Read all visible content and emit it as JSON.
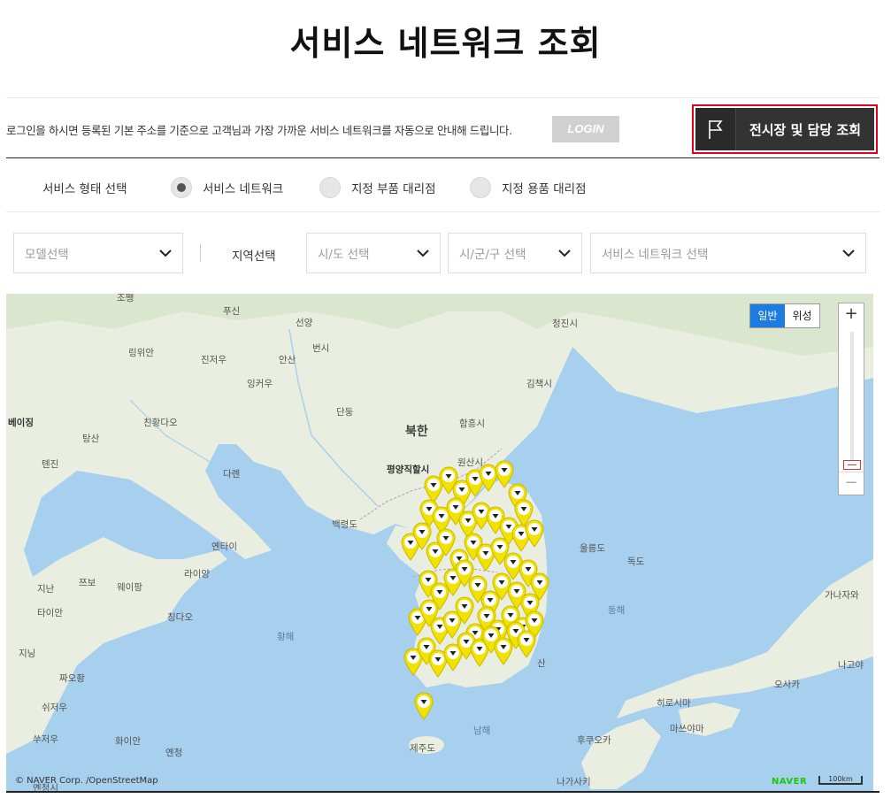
{
  "page": {
    "title": "서비스 네트워크 조회"
  },
  "login": {
    "message": "로그인을 하시면 등록된 기본 주소를 기준으로 고객님과 가장 가까운 서비스 네트워크를 자동으로 안내해 드립니다.",
    "button_label": "LOGIN"
  },
  "showroom": {
    "button_label": "전시장 및 담당 조회",
    "icon": "flag-icon"
  },
  "service_type": {
    "label": "서비스 형태 선택",
    "options": [
      {
        "label": "서비스 네트워크",
        "selected": true
      },
      {
        "label": "지정 부품 대리점",
        "selected": false
      },
      {
        "label": "지정 용품 대리점",
        "selected": false
      }
    ]
  },
  "filters": {
    "model_placeholder": "모델선택",
    "region_label": "지역선택",
    "province_placeholder": "시/도 선택",
    "city_placeholder": "시/군/구 선택",
    "network_placeholder": "서비스 네트워크 선택"
  },
  "map": {
    "type_buttons": [
      "일반",
      "위성"
    ],
    "active_type": "일반",
    "zoom_in": "+",
    "zoom_out": "−",
    "copyright": "© NAVER Corp. /OpenStreetMap",
    "logo": "NAVER",
    "scale": "100km",
    "marker_color": "#f2e200",
    "labels": {
      "zhangjiakou_partial": "조쨍",
      "fuxin": "푸신",
      "shenyang": "선양",
      "fushun": "번시",
      "jilin_partial": "청진시",
      "jinzhou": "진저우",
      "anshan": "안산",
      "yingkou": "잉커우",
      "linyi": "링위안",
      "kimchaek": "김책시",
      "beijing": "베이징",
      "qinhuangdao": "친황다오",
      "dandong": "단둥",
      "hamhung": "함흥시",
      "tangshan": "탕산",
      "north_korea": "북한",
      "tianjin": "톈진",
      "pyongyang": "평양직할시",
      "wonsan": "원산시",
      "dalian": "다롄",
      "baengnyeongdo": "백령도",
      "ulleungdo": "울릉도",
      "dokdo": "독도",
      "yantai": "옌타이",
      "jinan": "지난",
      "zibo": "쯔보",
      "weifang": "웨이팡",
      "laiyang": "라이양",
      "taian": "타이안",
      "qingdao": "칭다오",
      "yellow_sea": "황해",
      "east_sea": "동해",
      "jining": "지닝",
      "busan_partial": "산",
      "kanazawa": "가나자와",
      "nagoya": "나고야",
      "zaozhuang": "짜오좡",
      "osaka": "오사카",
      "hiroshima": "히로시마",
      "xuzhou": "쉬저우",
      "matsuyama": "마쓰야마",
      "south_sea": "남해",
      "suzhou": "쑤저우",
      "huaian": "화이안",
      "fukuoka": "후쿠오카",
      "yancheng": "옌청",
      "jeju_partial": "제주도",
      "nagasaki": "나가사키",
      "yancheng_bottom": "옌청시"
    }
  }
}
